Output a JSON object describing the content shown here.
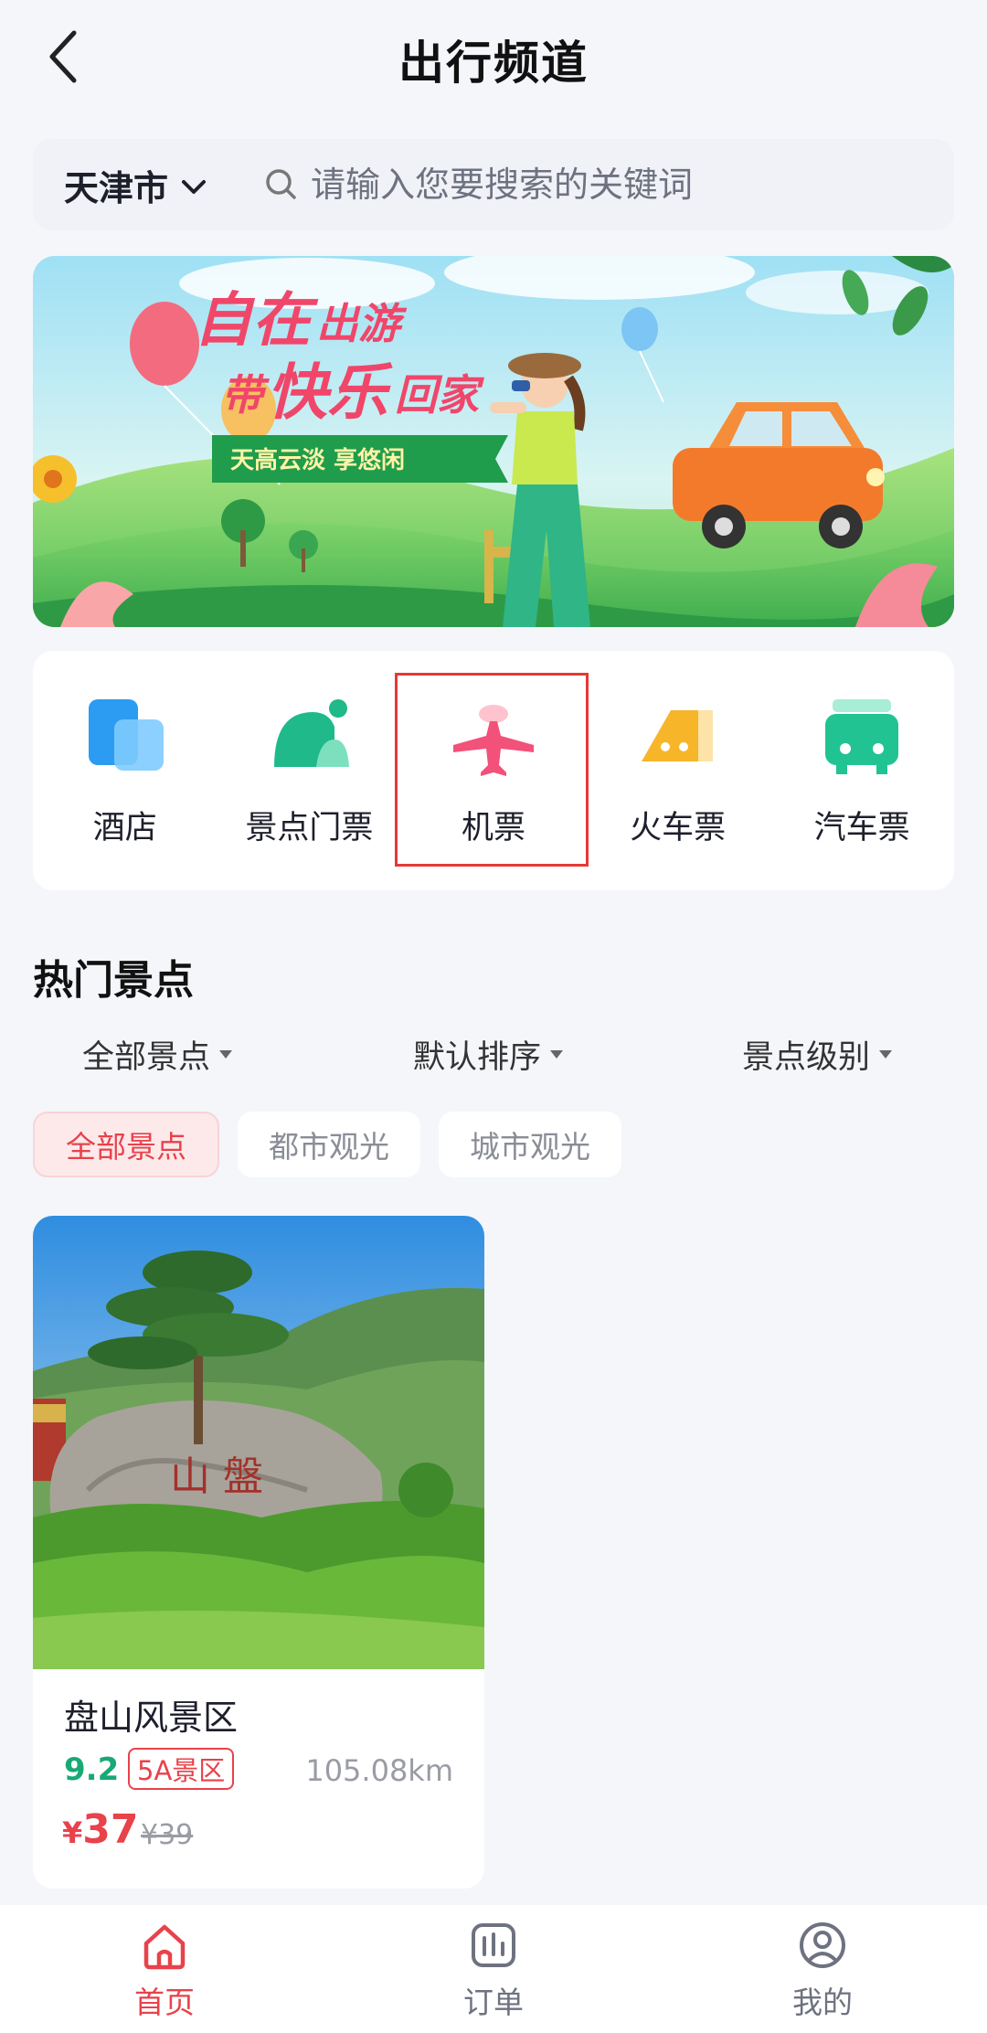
{
  "header": {
    "title": "出行频道"
  },
  "search": {
    "city": "天津市",
    "placeholder": "请输入您要搜索的关键词"
  },
  "banner": {
    "headline_1a": "自在",
    "headline_1b": "出游",
    "headline_2a": "带",
    "headline_2b": "快乐",
    "headline_2c": "回家",
    "ribbon": "天高云淡 享悠闲"
  },
  "categories": [
    {
      "label": "酒店",
      "icon": "hotel-icon"
    },
    {
      "label": "景点门票",
      "icon": "scenic-ticket-icon"
    },
    {
      "label": "机票",
      "icon": "airplane-icon"
    },
    {
      "label": "火车票",
      "icon": "train-icon"
    },
    {
      "label": "汽车票",
      "icon": "bus-icon"
    }
  ],
  "hot": {
    "title": "热门景点",
    "filters": [
      "全部景点",
      "默认排序",
      "景点级别"
    ],
    "chips": [
      "全部景点",
      "都市观光",
      "城市观光"
    ],
    "active_chip": "全部景点"
  },
  "scenic": {
    "name": "盘山风景区",
    "rating": "9.2",
    "badge": "5A景区",
    "distance": "105.08km",
    "price_symbol": "¥",
    "price": "37",
    "original_price": "¥39",
    "rock_text": "山 盤"
  },
  "nav": [
    {
      "label": "首页",
      "icon": "home-icon",
      "active": true
    },
    {
      "label": "订单",
      "icon": "orders-icon",
      "active": false
    },
    {
      "label": "我的",
      "icon": "profile-icon",
      "active": false
    }
  ],
  "colors": {
    "accent": "#e8424b",
    "rating": "#19a974",
    "highlight": "#e53935"
  }
}
